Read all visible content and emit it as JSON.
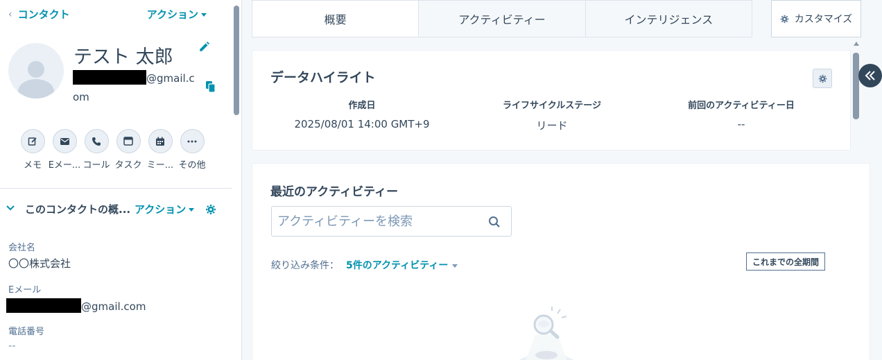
{
  "left_panel": {
    "back_label": "コンタクト",
    "actions_label": "アクション",
    "contact": {
      "name": "テスト 太郎",
      "email_domain_line1": "@gmail.c",
      "email_domain_line2": "om"
    },
    "quick_actions": [
      {
        "label": "メモ",
        "icon": "edit-icon"
      },
      {
        "label": "Eメー...",
        "icon": "email-icon"
      },
      {
        "label": "コール",
        "icon": "phone-icon"
      },
      {
        "label": "タスク",
        "icon": "task-icon"
      },
      {
        "label": "ミー...",
        "icon": "calendar-icon"
      },
      {
        "label": "その他",
        "icon": "more-icon"
      }
    ],
    "about_section": {
      "title": "このコンタクトの概...",
      "actions_label": "アクション",
      "properties": [
        {
          "label": "会社名",
          "value": "〇〇株式会社"
        },
        {
          "label": "Eメール",
          "value": "@gmail.com"
        },
        {
          "label": "電話番号",
          "value": "--"
        }
      ]
    }
  },
  "tabs": [
    {
      "label": "概要",
      "active": true
    },
    {
      "label": "アクティビティー",
      "active": false
    },
    {
      "label": "インテリジェンス",
      "active": false
    }
  ],
  "customize_label": "カスタマイズ",
  "highlights": {
    "title": "データハイライト",
    "fields": [
      {
        "label": "作成日",
        "value": "2025/08/01 14:00 GMT+9"
      },
      {
        "label": "ライフサイクルステージ",
        "value": "リード"
      },
      {
        "label": "前回のアクティビティー日",
        "value": "--"
      }
    ]
  },
  "activity": {
    "title": "最近のアクティビティー",
    "search_placeholder": "アクティビティーを検索",
    "filter_label": "絞り込み条件：",
    "filter_value": "5件のアクティビティー",
    "period_label": "これまでの全期間"
  },
  "colors": {
    "accent": "#0091ae",
    "text": "#33475b",
    "border": "#cbd6e2",
    "background": "#f5f8fa"
  }
}
